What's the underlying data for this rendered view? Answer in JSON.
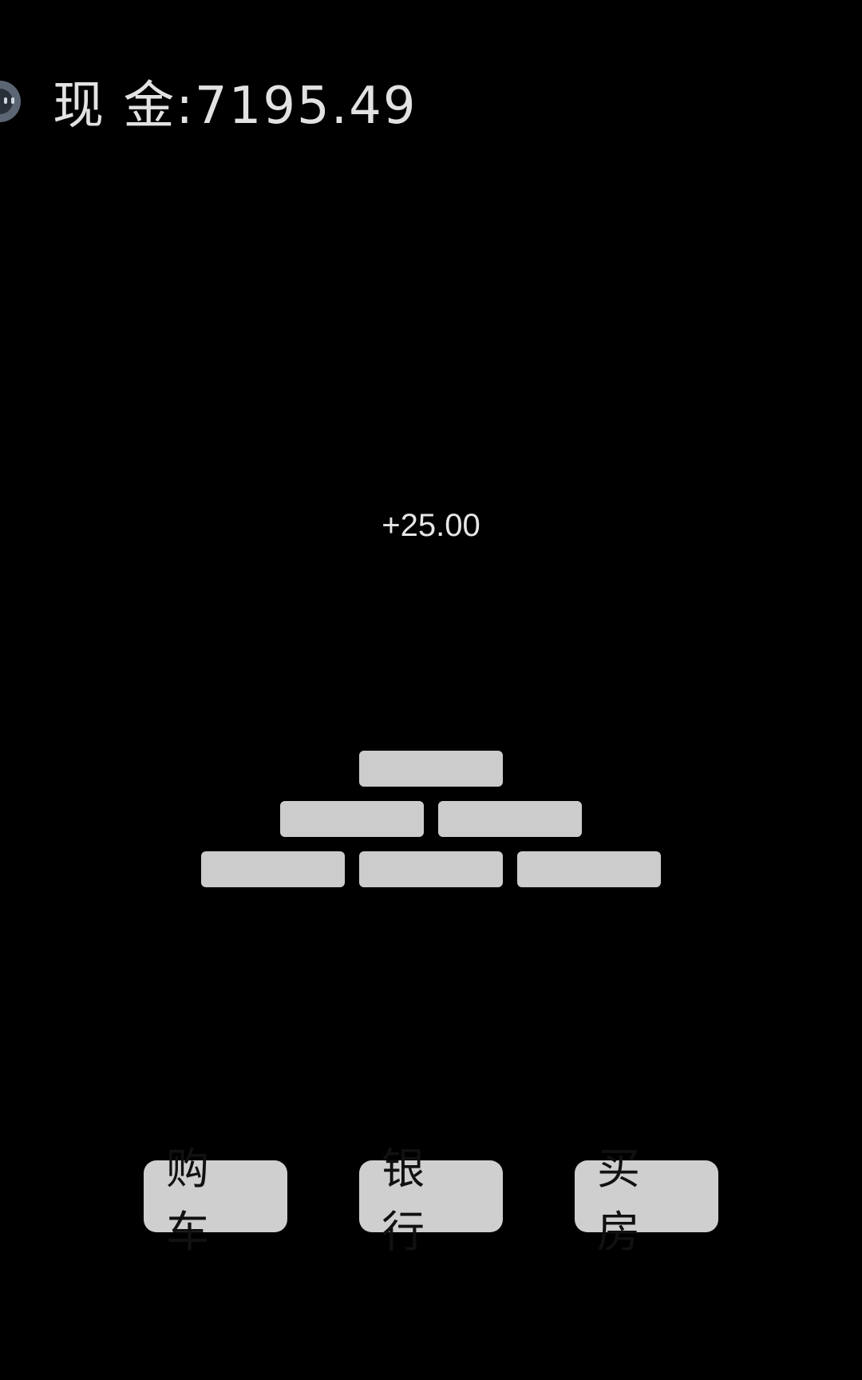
{
  "header": {
    "avatar_icon": "robot-face-icon",
    "cash_text": "现 金:7195.49"
  },
  "gain_text": "+25.00",
  "gold_bars": {
    "rows": [
      1,
      2,
      3
    ],
    "color": "#cccccc"
  },
  "actions": {
    "buy_car_label": "购车",
    "bank_label": "银行",
    "buy_house_label": "买房"
  },
  "colors": {
    "background": "#000000",
    "text": "#e2e2e2",
    "button": "#cfcfcf",
    "button_text": "#111111"
  }
}
